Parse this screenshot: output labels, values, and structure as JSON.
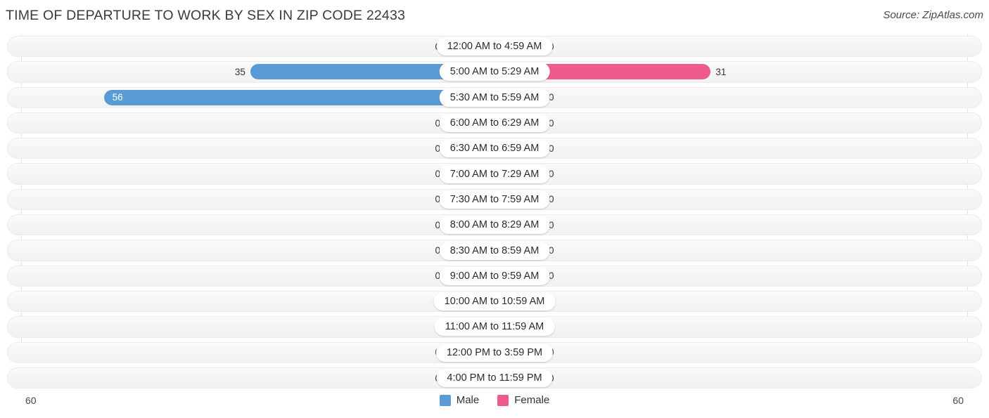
{
  "header": {
    "title": "TIME OF DEPARTURE TO WORK BY SEX IN ZIP CODE 22433",
    "source": "Source: ZipAtlas.com"
  },
  "legend": {
    "male_label": "Male",
    "female_label": "Female",
    "male_color": "#5B9BD5",
    "female_color": "#EF5C8C",
    "male_color_zero": "#AFCBEC",
    "female_color_zero": "#F7A8C4"
  },
  "axis": {
    "left_label": "60",
    "right_label": "60"
  },
  "chart_data": {
    "type": "bar",
    "orientation": "horizontal-diverging",
    "title": "TIME OF DEPARTURE TO WORK BY SEX IN ZIP CODE 22433",
    "xlabel": "",
    "ylabel": "",
    "xlim": [
      60,
      60
    ],
    "axis_max": 60,
    "grid": true,
    "legend_position": "bottom-center",
    "categories": [
      "12:00 AM to 4:59 AM",
      "5:00 AM to 5:29 AM",
      "5:30 AM to 5:59 AM",
      "6:00 AM to 6:29 AM",
      "6:30 AM to 6:59 AM",
      "7:00 AM to 7:29 AM",
      "7:30 AM to 7:59 AM",
      "8:00 AM to 8:29 AM",
      "8:30 AM to 8:59 AM",
      "9:00 AM to 9:59 AM",
      "10:00 AM to 10:59 AM",
      "11:00 AM to 11:59 AM",
      "12:00 PM to 3:59 PM",
      "4:00 PM to 11:59 PM"
    ],
    "series": [
      {
        "name": "Male",
        "values": [
          0,
          35,
          56,
          0,
          0,
          0,
          0,
          0,
          0,
          0,
          0,
          0,
          0,
          0
        ]
      },
      {
        "name": "Female",
        "values": [
          0,
          31,
          0,
          0,
          0,
          0,
          0,
          0,
          0,
          0,
          0,
          0,
          0,
          0
        ]
      }
    ]
  }
}
